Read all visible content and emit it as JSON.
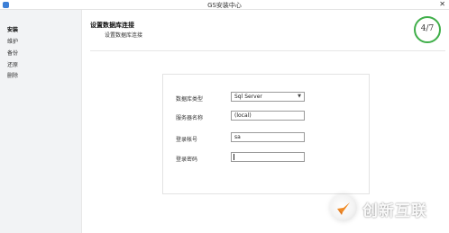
{
  "window": {
    "title": "GS安装中心",
    "close_glyph": "✕"
  },
  "sidebar": {
    "items": [
      {
        "label": "安装",
        "active": true
      },
      {
        "label": "维护",
        "active": false
      },
      {
        "label": "备份",
        "active": false
      },
      {
        "label": "还原",
        "active": false
      },
      {
        "label": "删除",
        "active": false
      }
    ]
  },
  "header": {
    "title": "设置数据库连接",
    "subtitle": "设置数据库连接",
    "step": "4/7"
  },
  "form": {
    "db_type": {
      "label": "数据库类型",
      "value": "Sql Server"
    },
    "server": {
      "label": "服务器名称",
      "value": "(local)"
    },
    "login": {
      "label": "登录帐号",
      "value": "sa"
    },
    "password": {
      "label": "登录密码",
      "value": ""
    }
  },
  "brand": {
    "name": "创新互联",
    "logo_icon": "brand-logo-icon"
  },
  "colors": {
    "progress_ring": "#3fae49",
    "sidebar_bg": "#f2f3f5",
    "app_icon": "#3d7fd6"
  }
}
